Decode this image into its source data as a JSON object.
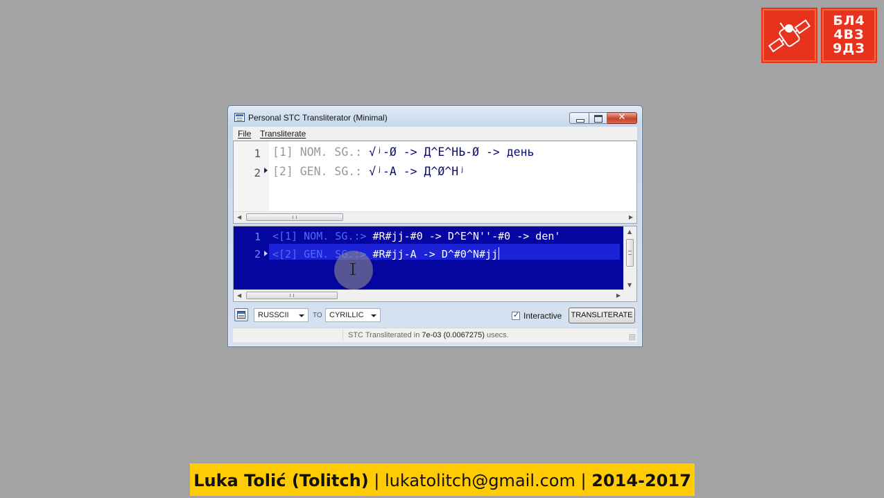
{
  "logo": {
    "text_lines": [
      "БЛ4",
      "4ВЗ",
      "9ДЗ"
    ],
    "color": "#e8321e"
  },
  "window": {
    "title": "Personal STC Transliterator (Minimal)",
    "menu": {
      "file": "File",
      "transliterate": "Transliterate"
    },
    "controls": {
      "close_glyph": "✕"
    }
  },
  "input_editor": {
    "lines": [
      {
        "number": "1",
        "label": "[1] NOM. SG.:",
        "text": " √ʲ-Ø -> Д^Е^НЬ-Ø -> день"
      },
      {
        "number": "2",
        "label": "[2] GEN. SG.:",
        "text": " √ʲ-А -> Д^Ø^Нʲ"
      }
    ]
  },
  "output_editor": {
    "lines": [
      {
        "number": "1",
        "label": "<[1] NOM. SG.:>",
        "text": " #R#jj-#0 -> D^E^N''-#0 -> den'"
      },
      {
        "number": "2",
        "label": "<[2] GEN. SG.:>",
        "text": " #R#jj-A -> D^#0^N#jj"
      }
    ],
    "background": "#0505a0"
  },
  "toolbar": {
    "from_encoding": "RUSSCII",
    "to_label": "TO",
    "to_encoding": "CYRILLIC",
    "interactive_label": "Interactive",
    "interactive_checked": true,
    "check_glyph": "✓",
    "transliterate_button": "TRANSLITERATE"
  },
  "status": {
    "prefix": "STC Transliterated in ",
    "time": "7e-03 (0.0067275)",
    "suffix": " usecs."
  },
  "banner": {
    "name": "Luka Tolić (Tolitch)",
    "sep1": " | ",
    "email": "lukatolitch@gmail.com",
    "sep2": " | ",
    "years": "2014-2017",
    "background": "#ffcb05"
  }
}
